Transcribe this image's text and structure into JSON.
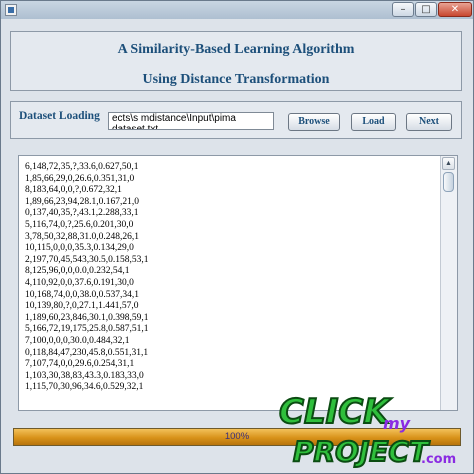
{
  "window": {
    "icons": {
      "app": "app-icon",
      "minimize": "minimize-icon",
      "maximize": "maximize-icon",
      "close": "close-icon"
    },
    "minimize_glyph": "–",
    "maximize_glyph": "□",
    "close_glyph": "✕"
  },
  "header": {
    "title_line1": "A Similarity-Based Learning Algorithm",
    "title_line2": "Using Distance Transformation"
  },
  "dataset_loading": {
    "label": "Dataset Loading",
    "path_value": "ects\\s mdistance\\Input\\pima dataset.txt",
    "browse_label": "Browse",
    "load_label": "Load",
    "next_label": "Next"
  },
  "data_view": {
    "lines": [
      "6,148,72,35,?,33.6,0.627,50,1",
      "1,85,66,29,0,26.6,0.351,31,0",
      "8,183,64,0,0,?,0.672,32,1",
      "1,89,66,23,94,28.1,0.167,21,0",
      "0,137,40,35,?,43.1,2.288,33,1",
      "5,116,74,0,?,25.6,0.201,30,0",
      "3,78,50,32,88,31.0,0.248,26,1",
      "10,115,0,0,0,35.3,0.134,29,0",
      "2,197,70,45,543,30.5,0.158,53,1",
      "8,125,96,0,0,0.0,0.232,54,1",
      "4,110,92,0,0,37.6,0.191,30,0",
      "10,168,74,0,0,38.0,0.537,34,1",
      "10,139,80,?,0,27.1,1.441,57,0",
      "1,189,60,23,846,30.1,0.398,59,1",
      "5,166,72,19,175,25.8,0.587,51,1",
      "7,100,0,0,0,30.0,0.484,32,1",
      "0,118,84,47,230,45.8,0.551,31,1",
      "7,107,74,0,0,29.6,0.254,31,1",
      "1,103,30,38,83,43.3,0.183,33,0",
      "1,115,70,30,96,34.6,0.529,32,1"
    ],
    "scroll_up_glyph": "▲"
  },
  "progress": {
    "percent": 100,
    "label": "100%"
  },
  "watermark": {
    "line1": "CLICK",
    "line2": "my",
    "line3": "PROJECT",
    "suffix": ".com",
    "colors": {
      "primary": "#2fbf3c",
      "outline": "#0b4c12",
      "accent": "#8a2be2"
    }
  }
}
